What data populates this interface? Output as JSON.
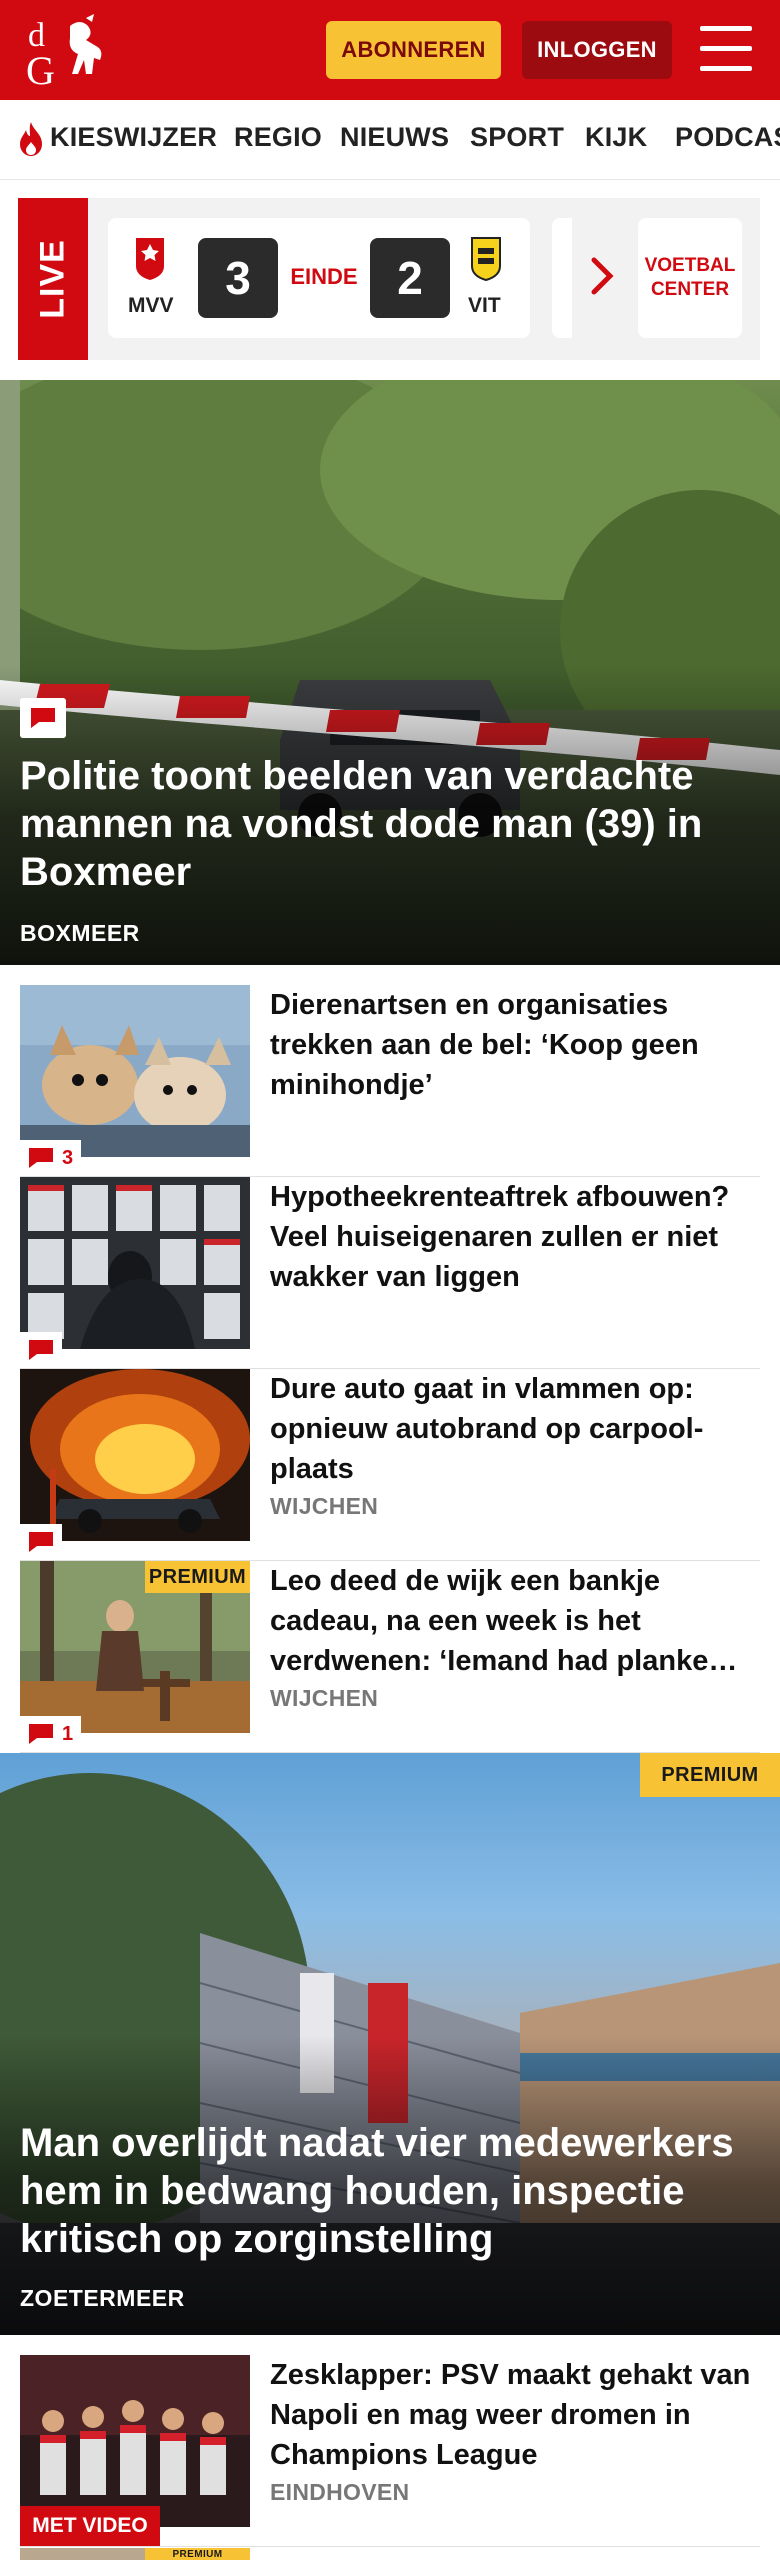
{
  "header": {
    "logo_text": "dG",
    "subscribe_label": "ABONNEREN",
    "login_label": "INLOGGEN",
    "brand_color": "#d10a11",
    "accent_color": "#f7c233"
  },
  "nav": {
    "items": [
      "KIESWIJZER",
      "REGIO",
      "NIEUWS",
      "SPORT",
      "KIJK",
      "PODCASTS"
    ]
  },
  "live": {
    "label": "LIVE",
    "match": {
      "home_team": "MVV",
      "home_score": "3",
      "status": "EINDE",
      "away_score": "2",
      "away_team": "VIT"
    },
    "voetbal_center": "VOETBAL CENTER"
  },
  "hero_articles": [
    {
      "title": "Politie toont beelden van verdachte mannen na vondst dode man (39) in Boxmeer",
      "place": "BOXMEER",
      "has_comments_icon": true
    },
    {
      "title": "Man overlijdt nadat vier medewerkers hem in bedwang houden, inspectie kritisch op zorginstelling",
      "place": "ZOETERMEER",
      "premium_label": "PREMIUM"
    }
  ],
  "articles": [
    {
      "title": "Dierenartsen en organisaties trekken aan de bel: ‘Koop geen minihondje’",
      "place": "",
      "comments": "3"
    },
    {
      "title": "Hypotheekrenteaftrek afbouwen? Veel huiseigenaren zullen er niet wakker van liggen",
      "place": "",
      "comments": ""
    },
    {
      "title": "Dure auto gaat in vlammen op: opnieuw autobrand op carpool-plaats",
      "place": "WIJCHEN",
      "comments": ""
    },
    {
      "title": "Leo deed de wijk een bankje cadeau, na een week is het verdwenen: ‘Iemand had planke…",
      "place": "WIJCHEN",
      "comments": "1",
      "premium_label": "PREMIUM"
    },
    {
      "title": "Zesklapper: PSV maakt gehakt van Napoli en mag weer dromen in Champions League",
      "place": "EINDHOVEN",
      "video_label": "MET VIDEO"
    }
  ],
  "partial_article": {
    "premium_label": "PREMIUM"
  }
}
